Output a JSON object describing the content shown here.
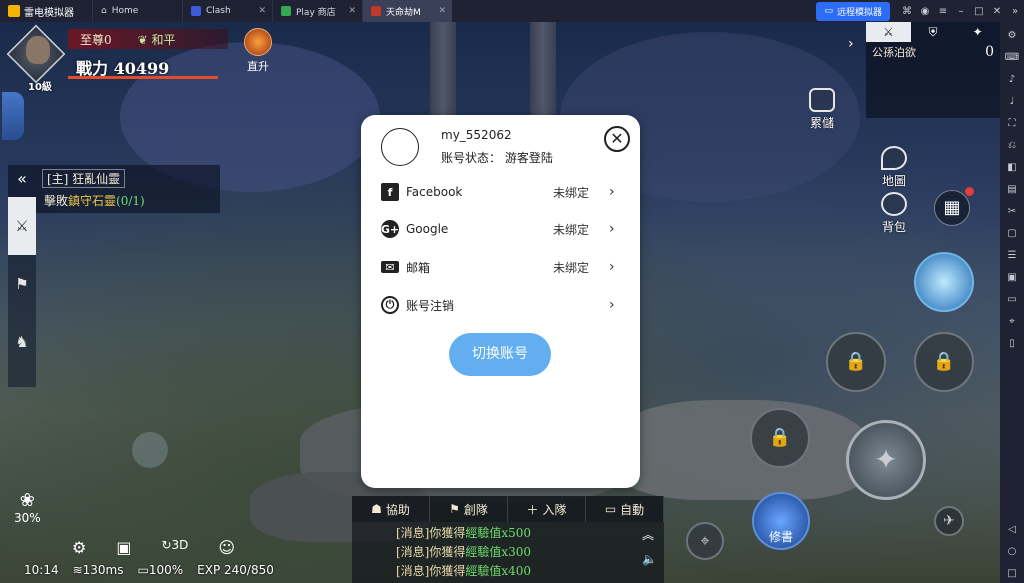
{
  "emulator": {
    "app_name": "雷电模拟器",
    "tabs": [
      {
        "label": "Home",
        "icon": "home-icon"
      },
      {
        "label": "Clash",
        "icon": "clash-icon"
      },
      {
        "label": "Play 商店",
        "icon": "play-store-icon"
      },
      {
        "label": "天命劫M",
        "icon": "game-icon"
      }
    ],
    "remote_button": "远程模拟器",
    "accent": "#2d6df6"
  },
  "player": {
    "rank": "至尊0",
    "mode": "和平",
    "power": "戰力 40499",
    "level": "10級",
    "direct_up": "直升"
  },
  "quest": {
    "title": "[主] 狂亂仙靈",
    "goal_prefix": "擊敗",
    "goal_target": "鎮守石靈",
    "goal_count": "(0/1)"
  },
  "right_hud": {
    "panel_label": "公孫泊欲",
    "panel_count": "0",
    "storage": "累儲",
    "map": "地圖",
    "bag": "背包"
  },
  "chat": {
    "actions": [
      "協助",
      "創隊",
      "入隊",
      "自動"
    ],
    "lines": [
      {
        "prefix": "[消息]你獲得",
        "exp": "經驗值x500"
      },
      {
        "prefix": "[消息]你獲得",
        "exp": "經驗值x300"
      },
      {
        "prefix": "[消息]你獲得",
        "exp": "經驗值x400"
      }
    ],
    "skill_label": "修書"
  },
  "status": {
    "time": "10:14",
    "ping": "130ms",
    "battery": "100%",
    "exp": "EXP 240/850",
    "percent": "30%",
    "view_mode": "3D"
  },
  "modal": {
    "username": "my_552062",
    "status": "账号状态： 游客登陆",
    "rows": [
      {
        "label": "Facebook",
        "state": "未绑定",
        "icon": "facebook-icon"
      },
      {
        "label": "Google",
        "state": "未绑定",
        "icon": "google-icon"
      },
      {
        "label": "邮箱",
        "state": "未绑定",
        "icon": "mail-icon"
      },
      {
        "label": "账号注销",
        "state": "",
        "icon": "power-icon"
      }
    ],
    "switch_button": "切换账号",
    "button_color": "#62aef0"
  }
}
